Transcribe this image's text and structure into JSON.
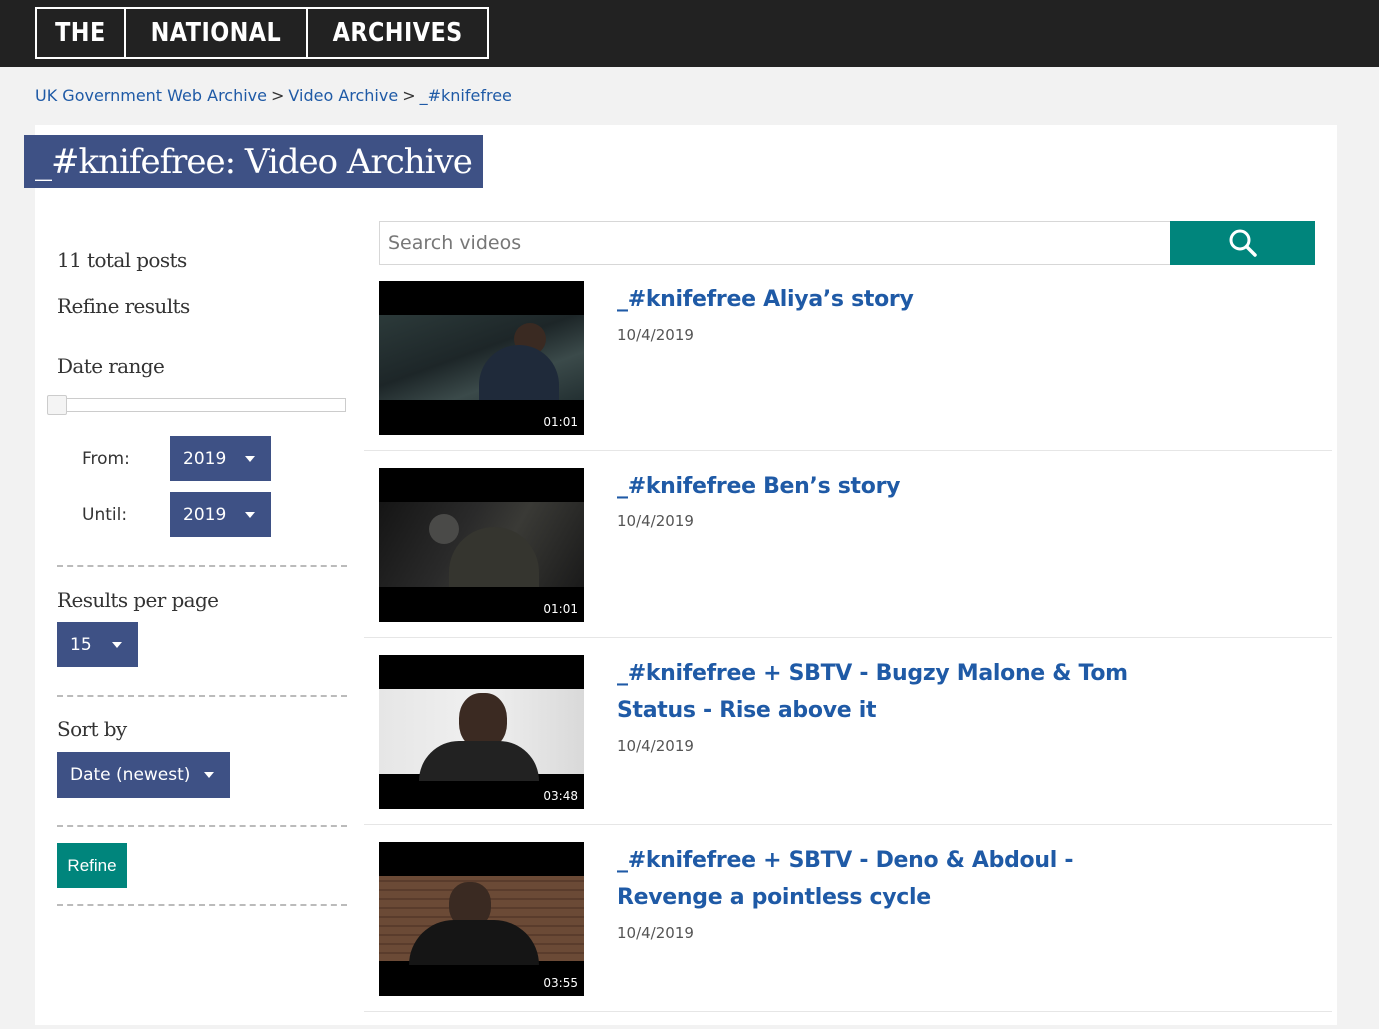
{
  "header": {
    "logo_segments": [
      "THE",
      "NATIONAL",
      "ARCHIVES"
    ]
  },
  "breadcrumb": {
    "items": [
      "UK Government Web Archive",
      "Video Archive",
      "_#knifefree"
    ],
    "separator": ">"
  },
  "page_title": "_#knifefree: Video Archive",
  "sidebar": {
    "total_posts": "11 total posts",
    "refine_heading": "Refine results",
    "date_range_heading": "Date range",
    "from_label": "From:",
    "from_value": "2019",
    "until_label": "Until:",
    "until_value": "2019",
    "results_per_page_heading": "Results per page",
    "results_per_page_value": "15",
    "sort_by_heading": "Sort by",
    "sort_by_value": "Date (newest)",
    "refine_button": "Refine"
  },
  "search": {
    "placeholder": "Search videos",
    "icon": "search-icon"
  },
  "videos": [
    {
      "title": "_#knifefree Aliya’s story",
      "date": "10/4/2019",
      "duration": "01:01"
    },
    {
      "title": "_#knifefree Ben’s story",
      "date": "10/4/2019",
      "duration": "01:01"
    },
    {
      "title": "_#knifefree + SBTV - Bugzy Malone & Tom Status - Rise above it",
      "date": "10/4/2019",
      "duration": "03:48"
    },
    {
      "title": "_#knifefree + SBTV - Deno & Abdoul - Revenge a pointless cycle",
      "date": "10/4/2019",
      "duration": "03:55"
    }
  ],
  "colors": {
    "header_bg": "#222222",
    "title_bg": "#3e5185",
    "accent_teal": "#00857c",
    "link_blue": "#1f5aa6"
  }
}
